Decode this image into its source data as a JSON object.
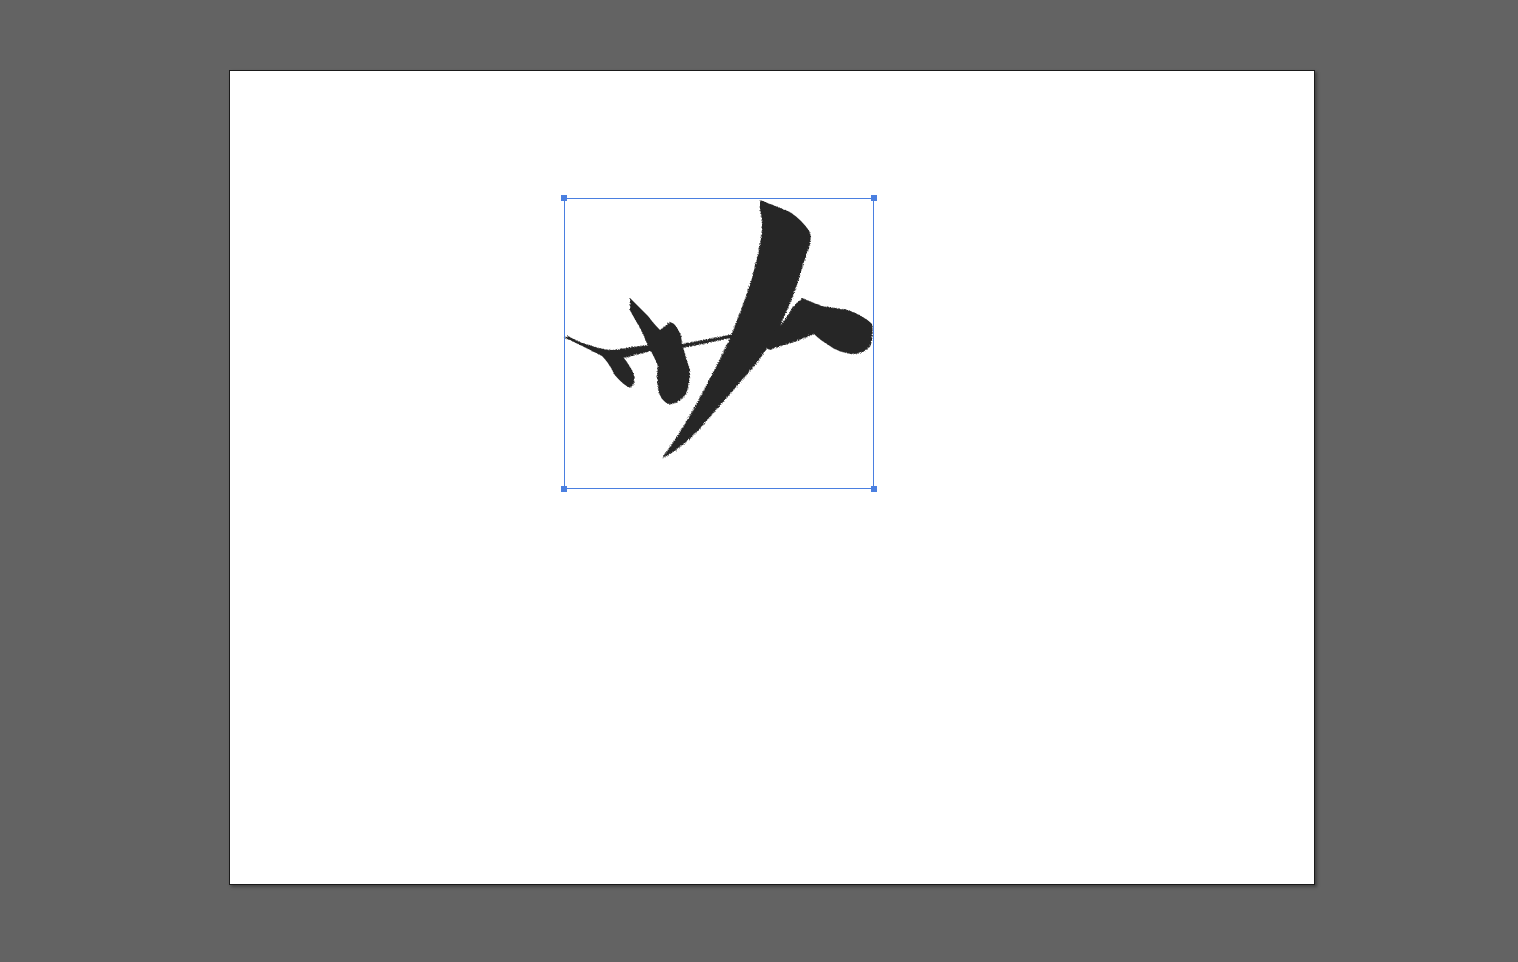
{
  "canvas": {
    "workspace_color": "#636363",
    "artboard_color": "#ffffff",
    "artboard_border_color": "#1a1a1a"
  },
  "placed_image": {
    "content": "brush-calligraphy-artwork",
    "ink_color": "#262626",
    "selected": true
  },
  "selection": {
    "color": "#4a7fe0",
    "handles": [
      "top-left",
      "top-right",
      "bottom-left",
      "bottom-right"
    ]
  }
}
